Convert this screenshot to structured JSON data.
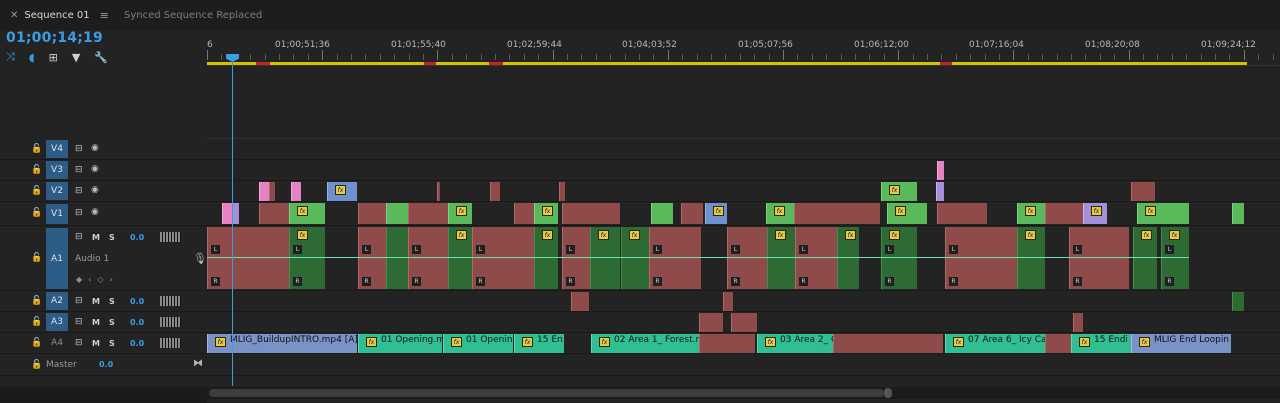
{
  "tabs": [
    {
      "label": "Sequence 01",
      "active": true
    },
    {
      "label": "Synced Sequence Replaced",
      "active": false
    }
  ],
  "timecode": "01;00;14;19",
  "ruler": {
    "start_label": "6",
    "labels": [
      "01;00;51;36",
      "01;01;55;40",
      "01;02;59;44",
      "01;04;03;52",
      "01;05;07;56",
      "01;06;12;00",
      "01;07;16;04",
      "01;08;20;08",
      "01;09;24;12"
    ]
  },
  "tracks": {
    "video": [
      {
        "id": "V4",
        "label": "V4"
      },
      {
        "id": "V3",
        "label": "V3"
      },
      {
        "id": "V2",
        "label": "V2"
      },
      {
        "id": "V1",
        "label": "V1"
      }
    ],
    "audio": [
      {
        "id": "A1",
        "label": "A1",
        "name": "Audio 1",
        "volume": "0.0"
      },
      {
        "id": "A2",
        "label": "A2",
        "volume": "0.0"
      },
      {
        "id": "A3",
        "label": "A3",
        "volume": "0.0"
      },
      {
        "id": "A4",
        "label": "A4",
        "volume": "0.0"
      }
    ],
    "master": {
      "label": "Master",
      "volume": "0.0"
    }
  },
  "m_label": "M",
  "s_label": "S",
  "a4_clips": [
    {
      "label": "MLIG_BuildupINTRO.mp4 [A]"
    },
    {
      "label": "01 Opening.m"
    },
    {
      "label": "01 Opening"
    },
    {
      "label": "15 En"
    },
    {
      "label": "02 Area 1_ Forest.m"
    },
    {
      "label": "03 Area 2_ O"
    },
    {
      "label": "07 Area 6_ Icy Ca"
    },
    {
      "label": "15 Endi"
    },
    {
      "label": "MLIG End Loopin"
    }
  ],
  "colors": {
    "accent": "#3a9ee4",
    "clip_red": "#8f4a4a",
    "clip_green": "#5ab95a",
    "clip_teal": "#2fbf93",
    "render_yellow": "#d4c200"
  }
}
